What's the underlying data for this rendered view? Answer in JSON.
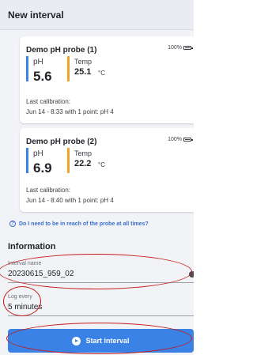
{
  "header": {
    "title": "New interval"
  },
  "probes": [
    {
      "name": "Demo pH probe (1)",
      "battery": "100%",
      "ph_label": "pH",
      "ph_value": "5.6",
      "temp_label": "Temp",
      "temp_value": "25.1",
      "temp_unit": "°C",
      "calibration_label": "Last calibration:",
      "calibration_text": "Jun 14 - 8:33 with 1 point: pH 4"
    },
    {
      "name": "Demo pH probe (2)",
      "battery": "100%",
      "ph_label": "pH",
      "ph_value": "6.9",
      "temp_label": "Temp",
      "temp_value": "22.2",
      "temp_unit": "°C",
      "calibration_label": "Last calibration:",
      "calibration_text": "Jun 14 - 8:40 with 1 point: pH 4"
    }
  ],
  "help": {
    "question": "Do I need to be in reach of the probe at all times?"
  },
  "information": {
    "title": "Information",
    "interval_name_label": "Interval name",
    "interval_name_value": "20230615_959_02",
    "log_every_label": "Log every",
    "log_every_value": "5 minutes"
  },
  "actions": {
    "start_label": "Start interval"
  },
  "colors": {
    "accent": "#3b82e6",
    "ph_bar": "#3b82e6",
    "temp_bar": "#f0a52a",
    "annotation": "#c51a1a"
  },
  "icons": {
    "battery": "battery-full-icon",
    "help": "question-circle-icon",
    "play": "play-circle-icon",
    "clear": "clear-icon"
  }
}
